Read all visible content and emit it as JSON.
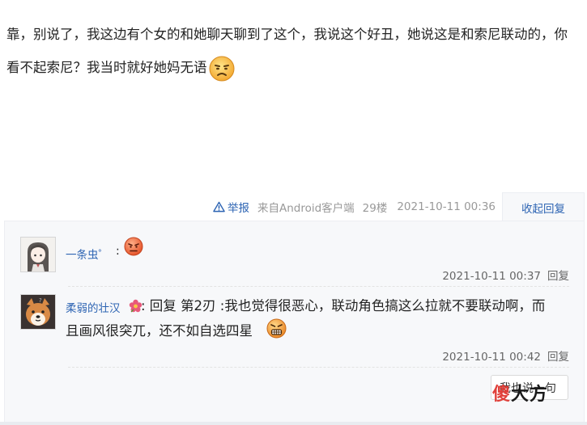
{
  "post": {
    "content": "靠，别说了，我这边有个女的和她聊天聊到了这个，我说这个好丑，她说这是和索尼联动的，你看不起索尼？我当时就好她妈无语",
    "emoji": "frown-face-emoji",
    "report_label": "举报",
    "client": "来自Android客户端",
    "floor": "29楼",
    "time": "2021-10-11 00:36",
    "collapse_label": "收起回复"
  },
  "replies": [
    {
      "username": "一条虫゜",
      "separator": ":",
      "emoji": "angry-red-face-emoji",
      "time": "2021-10-11 00:37",
      "reply_label": "回复"
    },
    {
      "username": "柔弱的壮汉",
      "flower_emoji": "flower-emoji",
      "content_line1": ": 回复 第2刃 :我也觉得很恶心，联动角色搞这么拉就不要联动啊，而",
      "content_line2": "且画风很突兀，还不如自选四星",
      "emoji": "grimace-face-emoji",
      "time": "2021-10-11 00:42",
      "reply_label": "回复"
    }
  ],
  "reply_box": {
    "button_label": "我也说一句"
  },
  "watermark": {
    "char1": "傻",
    "rest": "大方"
  },
  "colors": {
    "link": "#2d64b3",
    "panel_bg": "#f7f8fa",
    "meta": "#999999"
  }
}
